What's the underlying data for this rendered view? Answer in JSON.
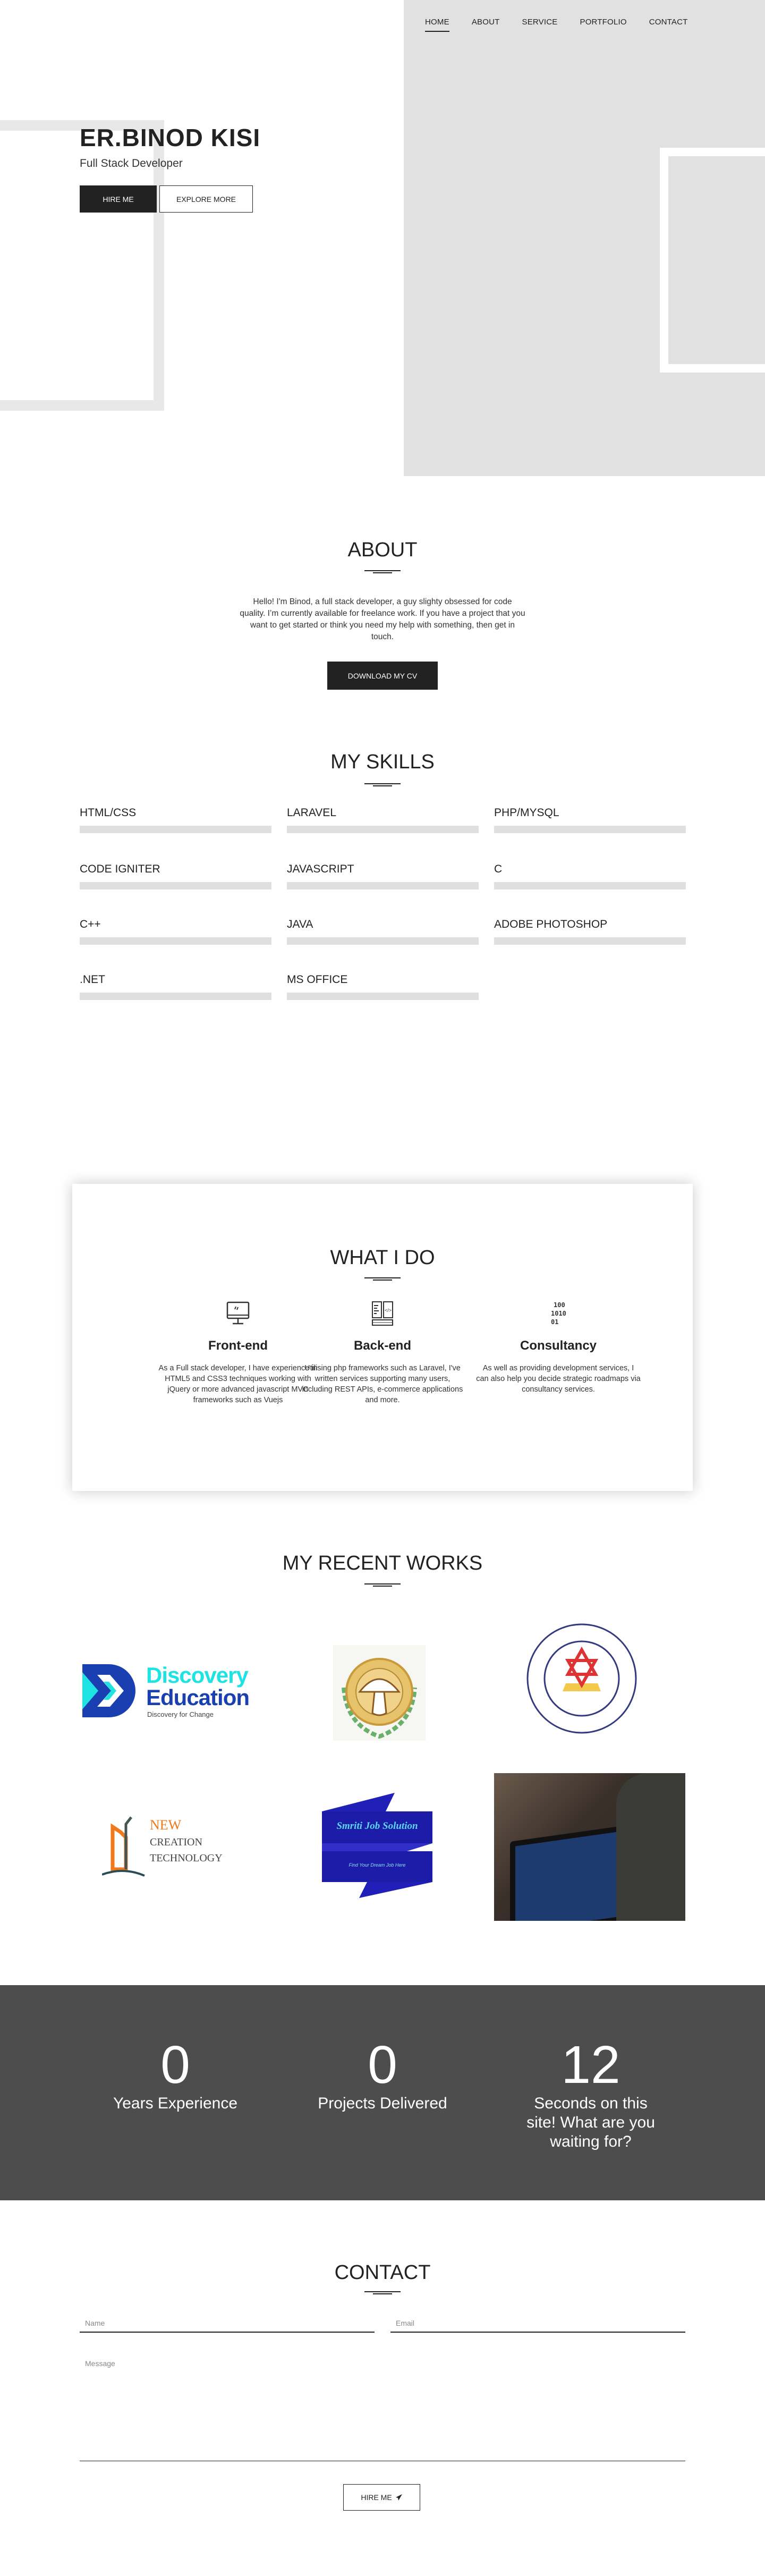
{
  "nav": {
    "items": [
      "HOME",
      "ABOUT",
      "SERVICE",
      "PORTFOLIO",
      "CONTACT"
    ]
  },
  "hero": {
    "name": "ER.BINOD KISI",
    "subtitle": "Full Stack Developer",
    "hire_label": "HIRE ME",
    "explore_label": "EXPLORE MORE"
  },
  "about": {
    "title": "ABOUT",
    "text": "Hello! I'm Binod, a full stack developer, a guy slighty obsessed for code quality. I’m currently available for freelance work. If you have a project that you want to get started or think you need my help with something, then get in touch.",
    "button": "DOWNLOAD MY CV"
  },
  "skills": {
    "title": "MY SKILLS",
    "items": [
      "HTML/CSS",
      "LARAVEL",
      "PHP/MYSQL",
      "CODE IGNITER",
      "JAVASCRIPT",
      "C",
      "C++",
      "JAVA",
      "ADOBE PHOTOSHOP",
      ".NET",
      "MS OFFICE"
    ]
  },
  "services": {
    "title": "WHAT I DO",
    "items": [
      {
        "icon": "monitor-icon",
        "title": "Front-end",
        "text": "As a Full stack developer, I have experience in HTML5 and CSS3 techniques working with jQuery or more advanced javascript MVC frameworks such as Vuejs"
      },
      {
        "icon": "code-editor-icon",
        "title": "Back-end",
        "text": "Utilising php frameworks such as Laravel, I've written services supporting many users, including REST APIs, e-commerce applications and more."
      },
      {
        "icon": "binary-icon",
        "title": "Consultancy",
        "text": "As well as providing development services, I can also help you decide strategic roadmaps via consultancy services."
      }
    ]
  },
  "works": {
    "title": "MY RECENT WORKS",
    "logos": {
      "discovery": [
        "Discovery",
        "Education",
        "Discovery for Change"
      ],
      "new_creation": [
        "NEW",
        "CREATION",
        "TECHNOLOGY"
      ],
      "smriti": [
        "Smriti Job Solution",
        "Find Your Dream Job Here"
      ]
    }
  },
  "stats": [
    {
      "num": "0",
      "label": "Years Experience"
    },
    {
      "num": "0",
      "label": "Projects Delivered"
    },
    {
      "num": "12",
      "label": "Seconds on this site! What are you waiting for?"
    }
  ],
  "contact": {
    "title": "CONTACT",
    "name_placeholder": "Name",
    "email_placeholder": "Email",
    "message_placeholder": "Message",
    "button": "HIRE ME"
  },
  "colors": {
    "panel": "#e1e1e1",
    "dark": "#222222",
    "stats_bg": "#4d4d4d"
  }
}
